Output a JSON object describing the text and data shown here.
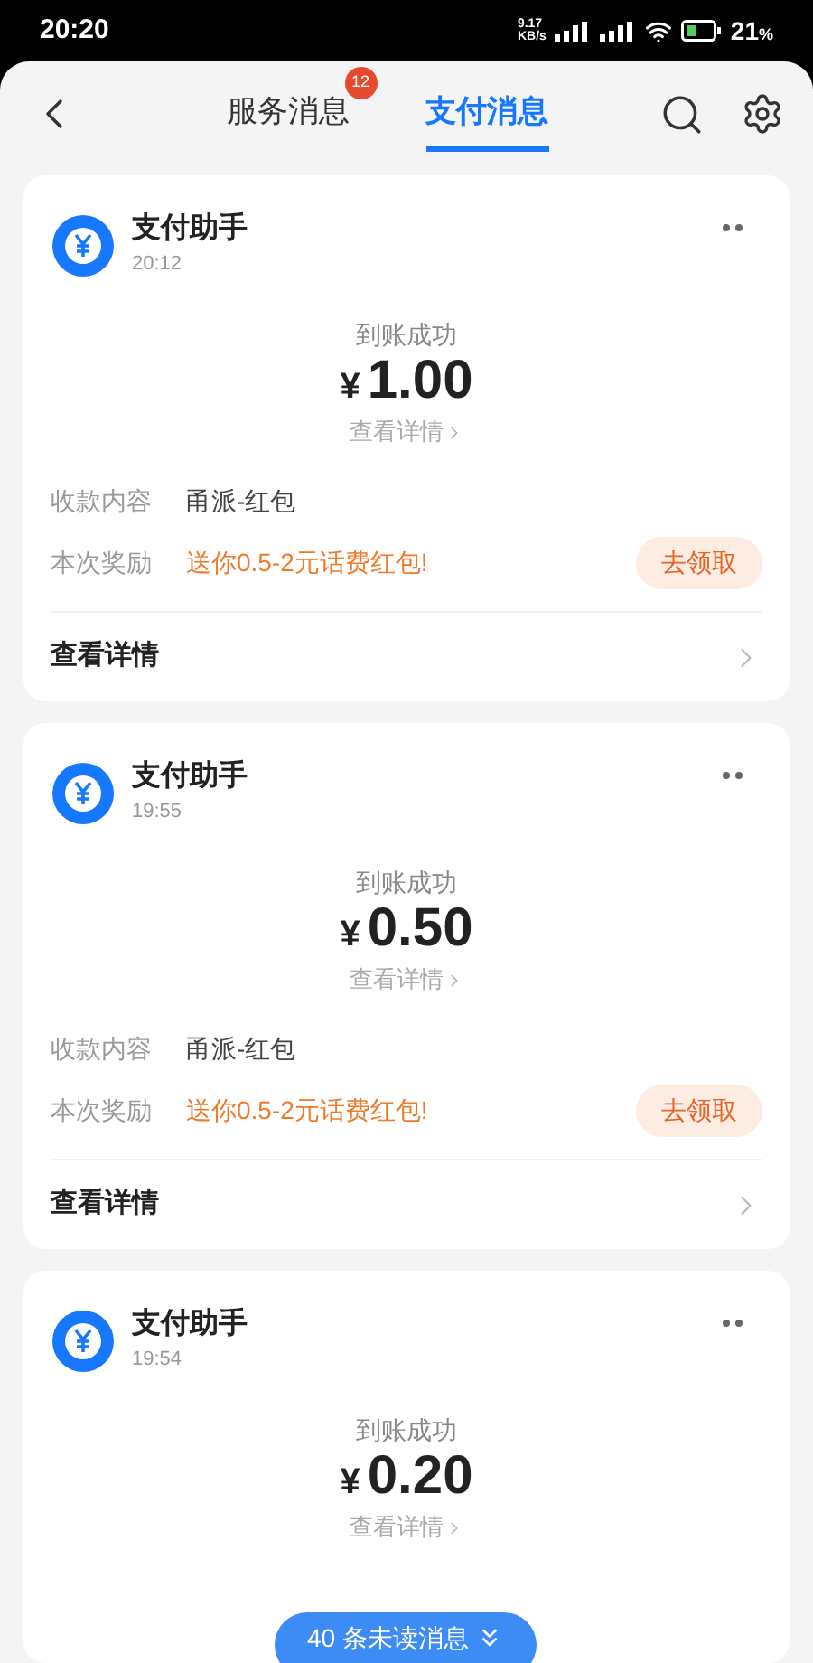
{
  "status_bar": {
    "time": "20:20",
    "net_speed": "9.17",
    "net_unit": "KB/s",
    "battery": "21",
    "battery_unit": "%"
  },
  "tabs": [
    {
      "label": "服务消息",
      "badge": "12",
      "selected": false
    },
    {
      "label": "支付消息",
      "selected": true
    }
  ],
  "messages": [
    {
      "sender": "支付助手",
      "time": "20:12",
      "status": "到账成功",
      "currency": "¥",
      "amount": "1.00",
      "detail_link": "查看详情",
      "rows": [
        {
          "kind": "plain",
          "label": "收款内容",
          "value": "甬派-红包"
        },
        {
          "kind": "promo",
          "label": "本次奖励",
          "value": "送你0.5-2元话费红包!",
          "action": "去领取"
        }
      ],
      "footer": "查看详情"
    },
    {
      "sender": "支付助手",
      "time": "19:55",
      "status": "到账成功",
      "currency": "¥",
      "amount": "0.50",
      "detail_link": "查看详情",
      "rows": [
        {
          "kind": "plain",
          "label": "收款内容",
          "value": "甬派-红包"
        },
        {
          "kind": "promo",
          "label": "本次奖励",
          "value": "送你0.5-2元话费红包!",
          "action": "去领取"
        }
      ],
      "footer": "查看详情"
    },
    {
      "sender": "支付助手",
      "time": "19:54",
      "status": "到账成功",
      "currency": "¥",
      "amount": "0.20",
      "detail_link": "查看详情"
    }
  ],
  "unread_pill": "40 条未读消息"
}
